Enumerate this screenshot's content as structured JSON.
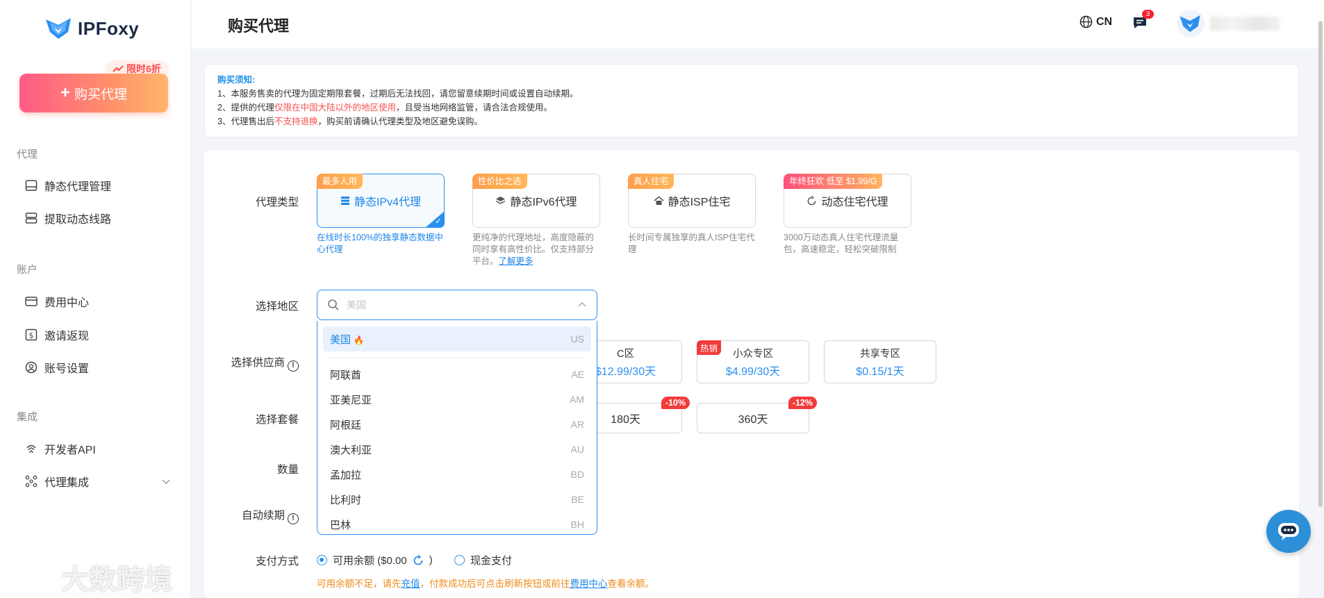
{
  "brand": {
    "name": "IPFoxy"
  },
  "sidebar": {
    "buy_button": "购买代理",
    "promo": "限时6折",
    "sections": [
      {
        "label": "代理",
        "items": [
          {
            "label": "静态代理管理",
            "icon": "server-icon"
          },
          {
            "label": "提取动态线路",
            "icon": "stack-icon"
          }
        ]
      },
      {
        "label": "账户",
        "items": [
          {
            "label": "费用中心",
            "icon": "card-icon"
          },
          {
            "label": "邀请返现",
            "icon": "dollar-icon"
          },
          {
            "label": "账号设置",
            "icon": "user-icon"
          }
        ]
      },
      {
        "label": "集成",
        "items": [
          {
            "label": "开发者API",
            "icon": "fingerprint-icon"
          },
          {
            "label": "代理集成",
            "icon": "network-icon"
          }
        ]
      }
    ]
  },
  "header": {
    "title": "购买代理",
    "lang": "CN",
    "message_count": "3"
  },
  "notice": {
    "title": "购买须知:",
    "line1": "1、本服务售卖的代理为固定期限套餐，过期后无法找回，请您留意续期时间或设置自动续期。",
    "line2_a": "2、提供的代理",
    "line2_b": "仅限在中国大陆以外的地区使用",
    "line2_c": "，且受当地网络监管，请合法合规使用。",
    "line3_a": "3、代理售出后",
    "line3_b": "不支持退换",
    "line3_c": "，购买前请确认代理类型及地区避免误购。"
  },
  "form": {
    "proxy_type_label": "代理类型",
    "region_label": "选择地区",
    "supplier_label": "选择供应商",
    "package_label": "选择套餐",
    "quantity_label": "数量",
    "auto_renew_label": "自动续期",
    "payment_label": "支付方式",
    "help_glyph": "!"
  },
  "proxy_types": [
    {
      "tag": "最多人用",
      "label": "静态IPv4代理",
      "desc": "在线时长100%的独享静态数据中心代理"
    },
    {
      "tag": "性价比之选",
      "label": "静态IPv6代理",
      "desc": "更纯净的代理地址，高度隐蔽的同时享有高性价比。仅支持部分平台。",
      "link": "了解更多"
    },
    {
      "tag": "真人住宅",
      "label": "静态ISP住宅",
      "desc": "长时间专属独享的真人ISP住宅代理"
    },
    {
      "tag": "年终狂欢 低至 $1.99/G",
      "label": "动态住宅代理",
      "desc": "3000万动态真人住宅代理流量包，高速稳定，轻松突破限制"
    }
  ],
  "region": {
    "placeholder": "美国",
    "options": [
      {
        "name": "美国",
        "code": "US"
      },
      {
        "name": "阿联酋",
        "code": "AE"
      },
      {
        "name": "亚美尼亚",
        "code": "AM"
      },
      {
        "name": "阿根廷",
        "code": "AR"
      },
      {
        "name": "澳大利亚",
        "code": "AU"
      },
      {
        "name": "孟加拉",
        "code": "BD"
      },
      {
        "name": "比利时",
        "code": "BE"
      },
      {
        "name": "巴林",
        "code": "BH"
      }
    ]
  },
  "suppliers": [
    {
      "name": "C区",
      "price": "$12.99/30天"
    },
    {
      "name": "小众专区",
      "price": "$4.99/30天",
      "tag": "热销"
    },
    {
      "name": "共享专区",
      "price": "$0.15/1天"
    }
  ],
  "packages": [
    {
      "label": "180天",
      "discount": "-10%"
    },
    {
      "label": "360天",
      "discount": "-12%"
    }
  ],
  "payment": {
    "balance_label": "可用余额 ($0.00",
    "balance_close": ")",
    "cash_label": "现金支付",
    "warn_a": "可用余额不足，请先",
    "warn_link1": "充值",
    "warn_b": "，付款成功后可点击刷新按钮或前往",
    "warn_link2": "费用中心",
    "warn_c": "查看余额。"
  },
  "watermark": "大数跨境"
}
